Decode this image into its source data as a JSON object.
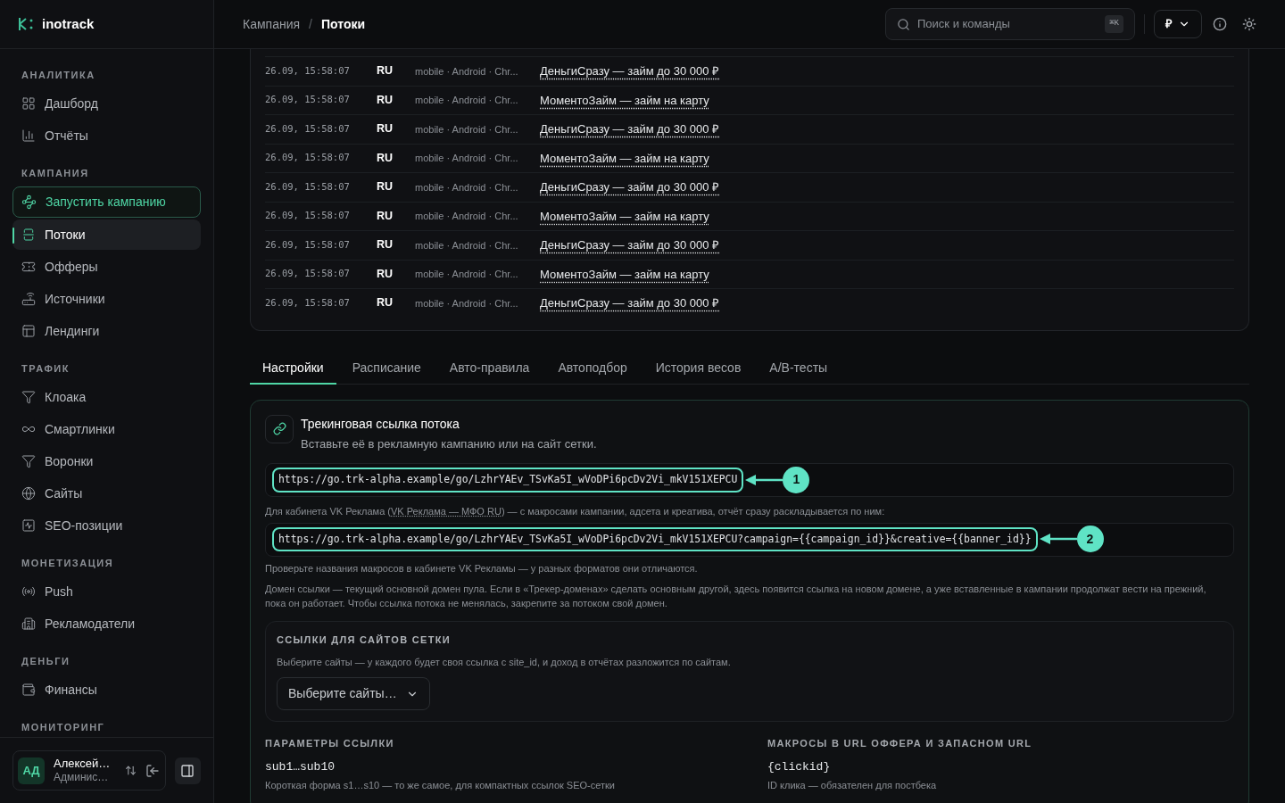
{
  "sidebar": {
    "logo": "inotrack",
    "sections": [
      {
        "title": "АНАЛИТИКА",
        "items": [
          {
            "label": "Дашборд",
            "kind": "link",
            "selected": false
          },
          {
            "label": "Отчёты",
            "kind": "link",
            "selected": false
          }
        ]
      },
      {
        "title": "КАМПАНИЯ",
        "items": [
          {
            "label": "Запустить кампанию",
            "kind": "cta",
            "selected": false
          },
          {
            "label": "Потоки",
            "kind": "link",
            "selected": true
          },
          {
            "label": "Офферы",
            "kind": "link",
            "selected": false
          },
          {
            "label": "Источники",
            "kind": "link",
            "selected": false
          },
          {
            "label": "Лендинги",
            "kind": "link",
            "selected": false
          }
        ]
      },
      {
        "title": "ТРАФИК",
        "items": [
          {
            "label": "Клоака",
            "kind": "link",
            "selected": false
          },
          {
            "label": "Смартлинки",
            "kind": "link",
            "selected": false
          },
          {
            "label": "Воронки",
            "kind": "link",
            "selected": false
          },
          {
            "label": "Сайты",
            "kind": "link",
            "selected": false
          },
          {
            "label": "SEO-позиции",
            "kind": "link",
            "selected": false
          }
        ]
      },
      {
        "title": "МОНЕТИЗАЦИЯ",
        "items": [
          {
            "label": "Push",
            "kind": "link",
            "selected": false
          },
          {
            "label": "Рекламодатели",
            "kind": "link",
            "selected": false
          }
        ]
      },
      {
        "title": "ДЕНЬГИ",
        "items": [
          {
            "label": "Финансы",
            "kind": "link",
            "selected": false
          }
        ]
      },
      {
        "title": "МОНИТОРИНГ"
      }
    ],
    "user": {
      "initials": "АД",
      "name": "Алексей…",
      "role": "Админис…"
    }
  },
  "header": {
    "breadcrumbs": [
      {
        "label": "Кампания",
        "selected": false
      },
      {
        "label": "Потоки",
        "selected": true
      }
    ],
    "separator": "/",
    "search": {
      "placeholder": "Поиск и команды"
    },
    "shortcut": "⌘K",
    "currency": "₽"
  },
  "clicks": [
    {
      "time": "26.09, 15:58:07",
      "country": "RU",
      "device": "mobile · Android · Chr...",
      "offer": "ДеньгиСразу — займ до 30 000 ₽"
    },
    {
      "time": "26.09, 15:58:07",
      "country": "RU",
      "device": "mobile · Android · Chr...",
      "offer": "МоментоЗайм — займ на карту"
    },
    {
      "time": "26.09, 15:58:07",
      "country": "RU",
      "device": "mobile · Android · Chr...",
      "offer": "ДеньгиСразу — займ до 30 000 ₽"
    },
    {
      "time": "26.09, 15:58:07",
      "country": "RU",
      "device": "mobile · Android · Chr...",
      "offer": "МоментоЗайм — займ на карту"
    },
    {
      "time": "26.09, 15:58:07",
      "country": "RU",
      "device": "mobile · Android · Chr...",
      "offer": "ДеньгиСразу — займ до 30 000 ₽"
    },
    {
      "time": "26.09, 15:58:07",
      "country": "RU",
      "device": "mobile · Android · Chr...",
      "offer": "МоментоЗайм — займ на карту"
    },
    {
      "time": "26.09, 15:58:07",
      "country": "RU",
      "device": "mobile · Android · Chr...",
      "offer": "ДеньгиСразу — займ до 30 000 ₽"
    },
    {
      "time": "26.09, 15:58:07",
      "country": "RU",
      "device": "mobile · Android · Chr...",
      "offer": "МоментоЗайм — займ на карту"
    },
    {
      "time": "26.09, 15:58:07",
      "country": "RU",
      "device": "mobile · Android · Chr...",
      "offer": "ДеньгиСразу — займ до 30 000 ₽"
    }
  ],
  "tabs": [
    {
      "label": "Настройки",
      "selected": true
    },
    {
      "label": "Расписание",
      "selected": false
    },
    {
      "label": "Авто-правила",
      "selected": false
    },
    {
      "label": "Автоподбор",
      "selected": false
    },
    {
      "label": "История весов",
      "selected": false
    },
    {
      "label": "A/B-тесты",
      "selected": false
    }
  ],
  "link_card": {
    "title": "Трекинговая ссылка потока",
    "subtitle": "Вставьте её в рекламную кампанию или на сайт сетки.",
    "main_url": {
      "value": "https://go.trk-alpha.example/go/LzhrYAEv_TSvKa5I_wVoDPi6pcDv2Vi_mkV151XEPCU",
      "callout": "1"
    },
    "vk_note": {
      "before": "Для кабинета VK Реклама (",
      "link": "VK Реклама — МФО RU",
      "after": ") — с макросами кампании, адсета и креатива, отчёт сразу раскладывается по ним:"
    },
    "vk_url": {
      "value": "https://go.trk-alpha.example/go/LzhrYAEv_TSvKa5I_wVoDPi6pcDv2Vi_mkV151XEPCU?campaign={{campaign_id}}&creative={{banner_id}}",
      "callout": "2"
    },
    "check_note": "Проверьте названия макросов в кабинете VK Рекламы — у разных форматов они отличаются.",
    "domain_note": "Домен ссылки — текущий основной домен пула. Если в «Трекер-доменах» сделать основным другой, здесь появится ссылка на новом домене, а уже вставленные в кампании продолжат вести на прежний, пока он работает. Чтобы ссылка потока не менялась, закрепите за потоком свой домен.",
    "sites": {
      "title": "ССЫЛКИ ДЛЯ САЙТОВ СЕТКИ",
      "hint": "Выберите сайты — у каждого будет своя ссылка с site_id, и доход в отчётах разложится по сайтам.",
      "placeholder": "Выберите сайты…"
    },
    "params": [
      {
        "title": "ПАРАМЕТРЫ ССЫЛКИ",
        "code": "sub1…sub10",
        "desc": "Короткая форма s1…s10 — то же самое, для компактных ссылок SEO-сетки"
      },
      {
        "title": "МАКРОСЫ В URL ОФФЕРА И ЗАПАСНОМ URL",
        "code": "{clickid}",
        "desc": "ID клика — обязателен для постбека"
      }
    ]
  }
}
